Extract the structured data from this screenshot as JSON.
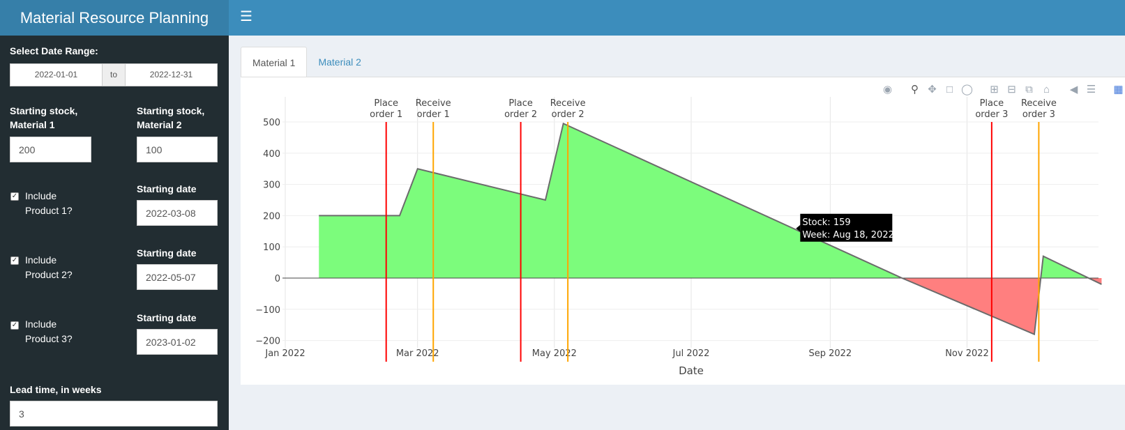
{
  "app": {
    "title": "Material Resource Planning"
  },
  "topbar": {
    "menu_icon": "hamburger-icon"
  },
  "sidebar": {
    "date_range_label": "Select Date Range:",
    "date_start": "2022-01-01",
    "date_sep": "to",
    "date_end": "2022-12-31",
    "stock1_label_line1": "Starting stock,",
    "stock1_label_line2": "Material 1",
    "stock1_value": "200",
    "stock2_label_line1": "Starting stock,",
    "stock2_label_line2": "Material 2",
    "stock2_value": "100",
    "products": [
      {
        "line1": "Include",
        "line2": "Product 1?",
        "checked": true,
        "date_label": "Starting date",
        "date": "2022-03-08"
      },
      {
        "line1": "Include",
        "line2": "Product 2?",
        "checked": true,
        "date_label": "Starting date",
        "date": "2022-05-07"
      },
      {
        "line1": "Include",
        "line2": "Product 3?",
        "checked": true,
        "date_label": "Starting date",
        "date": "2023-01-02"
      }
    ],
    "lead_time_label": "Lead time, in weeks",
    "lead_time_value": "3"
  },
  "tabs": [
    {
      "label": "Material 1",
      "active": true
    },
    {
      "label": "Material 2",
      "active": false
    }
  ],
  "modebar": [
    "camera-icon",
    "zoom-icon",
    "pan-icon",
    "box-select-icon",
    "lasso-icon",
    "zoom-in-icon",
    "zoom-out-icon",
    "autoscale-icon",
    "home-icon",
    "spike-icon",
    "hover-compare-icon",
    "plotly-logo-icon"
  ],
  "colors": {
    "positive_fill": "#7cfc7c",
    "negative_fill": "#ff7f7f",
    "place_line": "#ff0000",
    "receive_line": "#ffa500"
  },
  "chart_data": {
    "type": "area",
    "xlabel": "Date",
    "ylim": [
      -200,
      500
    ],
    "yticks": [
      "500",
      "400",
      "300",
      "200",
      "100",
      "0",
      "−200",
      "−100"
    ],
    "ytick_values": [
      500,
      400,
      300,
      200,
      100,
      0,
      -200,
      -100
    ],
    "xticks": [
      "Jan 2022",
      "Mar 2022",
      "May 2022",
      "Jul 2022",
      "Sep 2022",
      "Nov 2022"
    ],
    "xtick_dates": [
      "2022-01-01",
      "2022-03-01",
      "2022-05-01",
      "2022-07-01",
      "2022-09-01",
      "2022-11-01"
    ],
    "series": [
      {
        "x": [
          "2022-01-16",
          "2022-02-21",
          "2022-03-01",
          "2022-04-27",
          "2022-05-05",
          "2022-10-03",
          "2022-12-01",
          "2022-12-05",
          "2022-12-31"
        ],
        "y": [
          200,
          200,
          350,
          250,
          495,
          0,
          -180,
          70,
          -20
        ]
      }
    ],
    "annotations": [
      {
        "line1": "Place",
        "line2": "order 1",
        "date": "2022-02-15",
        "kind": "place"
      },
      {
        "line1": "Receive",
        "line2": "order 1",
        "date": "2022-03-08",
        "kind": "receive"
      },
      {
        "line1": "Place",
        "line2": "order 2",
        "date": "2022-04-16",
        "kind": "place"
      },
      {
        "line1": "Receive",
        "line2": "order 2",
        "date": "2022-05-07",
        "kind": "receive"
      },
      {
        "line1": "Place",
        "line2": "order 3",
        "date": "2022-11-12",
        "kind": "place"
      },
      {
        "line1": "Receive",
        "line2": "order 3",
        "date": "2022-12-03",
        "kind": "receive"
      }
    ],
    "tooltip": {
      "line1": "Stock: 159",
      "line2": "Week: Aug 18, 2022",
      "x": "2022-08-18",
      "y": 159
    }
  }
}
